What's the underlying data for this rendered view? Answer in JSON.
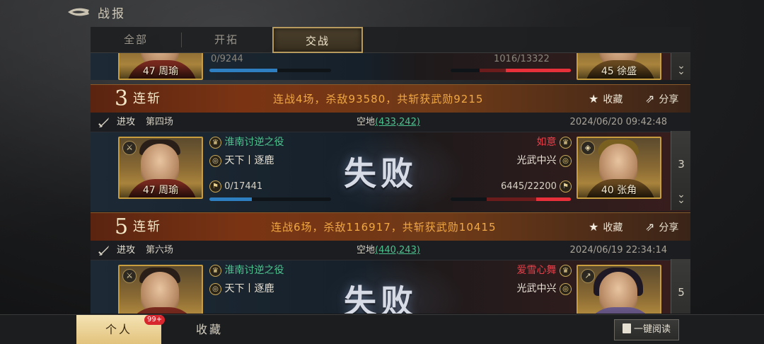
{
  "header": {
    "title": "战报"
  },
  "tabs": [
    {
      "label": "全部"
    },
    {
      "label": "开拓"
    },
    {
      "label": "交战"
    }
  ],
  "colors": {
    "accent_gold": "#c79d3e",
    "win_green": "#4cc28e",
    "enemy_red": "#e8404a",
    "summary_orange": "#f0a844"
  },
  "partial_card": {
    "left_general": "47 周瑜",
    "left_troops": "0/9244",
    "right_troops": "1016/13322",
    "right_general": "45 徐盛"
  },
  "cards": [
    {
      "streak_num": "3",
      "streak_label": "连斩",
      "summary": "连战4场，杀敌93580，共斩获武勋9215",
      "favorite_label": "收藏",
      "share_label": "分享",
      "attack_label": "进攻",
      "round_label": "第四场",
      "land_label": "空地",
      "coord": "(433,242)",
      "time": "2024/06/20 09:42:48",
      "left": {
        "general": "47 周瑜",
        "campaign": "淮南讨逆之役",
        "alliance": "天下丨逐鹿",
        "troops": "0/17441",
        "troop_fill": 0.35
      },
      "result": "失败",
      "right": {
        "player": "如意",
        "alliance": "光武中兴",
        "troops": "6445/22200",
        "troop_fill": 0.29,
        "general": "40 张角"
      },
      "count": "3"
    },
    {
      "streak_num": "5",
      "streak_label": "连斩",
      "summary": "连战6场，杀敌116917，共斩获武勋10415",
      "favorite_label": "收藏",
      "share_label": "分享",
      "attack_label": "进攻",
      "round_label": "第六场",
      "land_label": "空地",
      "coord": "(440,243)",
      "time": "2024/06/19 22:34:14",
      "left": {
        "campaign": "淮南讨逆之役",
        "alliance": "天下丨逐鹿"
      },
      "result": "失败",
      "right": {
        "player": "爱雪心舞",
        "alliance": "光武中兴"
      },
      "count": "5"
    }
  ],
  "bottom": {
    "tab_personal": "个人",
    "notif": "99+",
    "tab_favorites": "收藏",
    "read_all": "一键阅读"
  }
}
